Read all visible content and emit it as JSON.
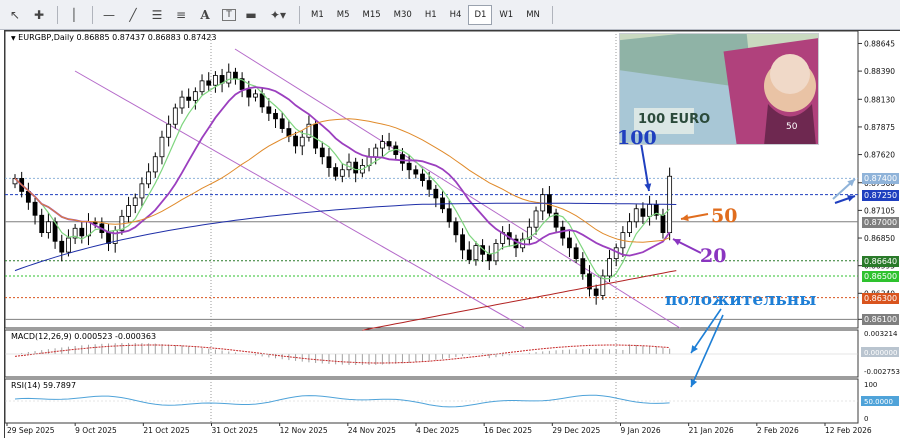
{
  "toolbar": {
    "timeframes": [
      "M1",
      "M5",
      "M15",
      "M30",
      "H1",
      "H4",
      "D1",
      "W1",
      "MN"
    ],
    "active_timeframe": "D1"
  },
  "chart_header": {
    "symbol": "EURGBP,Daily",
    "ohlc": "0.86885 0.87437 0.86883 0.87423"
  },
  "price_axis": {
    "labels": [
      "0.88645",
      "0.88390",
      "0.88130",
      "0.87875",
      "0.87620",
      "0.87360",
      "0.87105",
      "0.86850",
      "0.86595",
      "0.86340",
      "0.86100"
    ],
    "highlighted": [
      {
        "value": "0.87400",
        "color": "#8fb3d9"
      },
      {
        "value": "0.87250",
        "color": "#1f3fbf"
      },
      {
        "value": "0.87000",
        "color": "#7f7f7f"
      },
      {
        "value": "0.86640",
        "color": "#2a7a2a"
      },
      {
        "value": "0.86500",
        "color": "#2ec22e"
      },
      {
        "value": "0.86300",
        "color": "#d9541e"
      },
      {
        "value": "0.86100",
        "color": "#7f7f7f"
      }
    ]
  },
  "macd_panel": {
    "label": "MACD(12,26,9) 0.000523 -0.000363",
    "axis": [
      "0.003214",
      "0.000000",
      "-0.002753"
    ]
  },
  "rsi_panel": {
    "label": "RSI(14) 59.7897",
    "axis": [
      "100",
      "50.0000",
      "0"
    ]
  },
  "time_axis": [
    "29 Sep 2025",
    "9 Oct 2025",
    "21 Oct 2025",
    "31 Oct 2025",
    "12 Nov 2025",
    "24 Nov 2025",
    "4 Dec 2025",
    "16 Dec 2025",
    "29 Dec 2025",
    "9 Jan 2026",
    "21 Jan 2026",
    "2 Feb 2026",
    "12 Feb 2026"
  ],
  "annotations": {
    "ma100": "100",
    "ma50": "50",
    "ma20": "20",
    "note": "положительны"
  },
  "colors": {
    "bull": "#ffffff",
    "bear": "#000000",
    "ma20": "#9b3fbf",
    "ma50": "#e08a2a",
    "ma100": "#1f2fa8",
    "ma200": "#b22222",
    "fast": "#7fd67f",
    "arrow_blue": "#1f3fbf",
    "arrow_light": "#8fb3d9",
    "arrow_orange": "#e06d1e",
    "arrow_purple": "#8a35c0",
    "note_blue": "#1e7fd6"
  }
}
